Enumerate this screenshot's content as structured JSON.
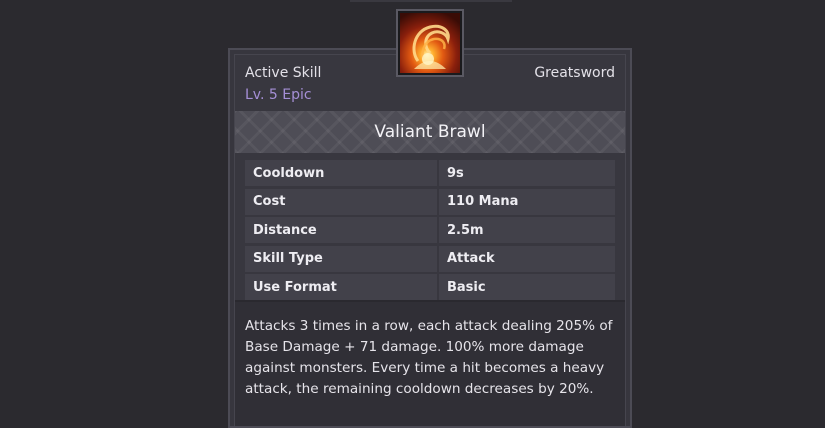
{
  "skill": {
    "icon": "flame-swirl-icon",
    "kind": "Active Skill",
    "level": "Lv. 5 Epic",
    "weapon": "Greatsword",
    "name": "Valiant Brawl"
  },
  "stats": [
    {
      "label": "Cooldown",
      "value": "9s"
    },
    {
      "label": "Cost",
      "value": "110 Mana"
    },
    {
      "label": "Distance",
      "value": "2.5m"
    },
    {
      "label": "Skill Type",
      "value": "Attack"
    },
    {
      "label": "Use Format",
      "value": "Basic"
    }
  ],
  "description": "Attacks 3 times in a row, each attack dealing 205% of Base Damage + 71 damage. 100% more damage against monsters. Every time a hit becomes a heavy attack, the remaining cooldown decreases by 20%.",
  "colors": {
    "background": "#2b2a2f",
    "panel": "#37363e",
    "level_text": "#a58fd6",
    "title_band": "#4e4d56"
  }
}
